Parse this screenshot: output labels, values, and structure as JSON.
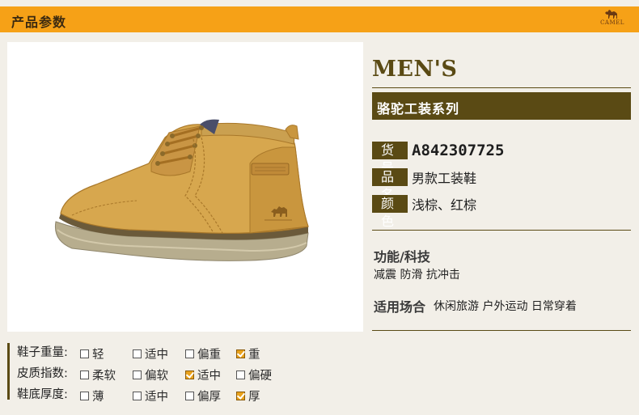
{
  "header": {
    "title": "产品参数",
    "brand": "CAMEL"
  },
  "product": {
    "gender_title": "MEN'S",
    "series": "骆驼工装系列",
    "fields": [
      {
        "label": "货号",
        "value": "A842307725"
      },
      {
        "label": "品名",
        "value": "男款工装鞋"
      },
      {
        "label": "颜色",
        "value": "浅棕、红棕"
      }
    ],
    "features_title": "功能/科技",
    "features": "减震 防滑 抗冲击",
    "scene_label": "适用场合",
    "scene_value": "休闲旅游 户外运动 日常穿着"
  },
  "specs": [
    {
      "label": "鞋子重量:",
      "options": [
        {
          "text": "轻",
          "checked": false
        },
        {
          "text": "适中",
          "checked": false
        },
        {
          "text": "偏重",
          "checked": false
        },
        {
          "text": "重",
          "checked": true
        }
      ]
    },
    {
      "label": "皮质指数:",
      "options": [
        {
          "text": "柔软",
          "checked": false
        },
        {
          "text": "偏软",
          "checked": false
        },
        {
          "text": "适中",
          "checked": true
        },
        {
          "text": "偏硬",
          "checked": false
        }
      ]
    },
    {
      "label": "鞋底厚度:",
      "options": [
        {
          "text": "薄",
          "checked": false
        },
        {
          "text": "适中",
          "checked": false
        },
        {
          "text": "偏厚",
          "checked": false
        },
        {
          "text": "厚",
          "checked": true
        }
      ]
    }
  ],
  "colors": {
    "accent": "#f6a117",
    "olive": "#5a4a14",
    "check": "#e9a21c"
  }
}
